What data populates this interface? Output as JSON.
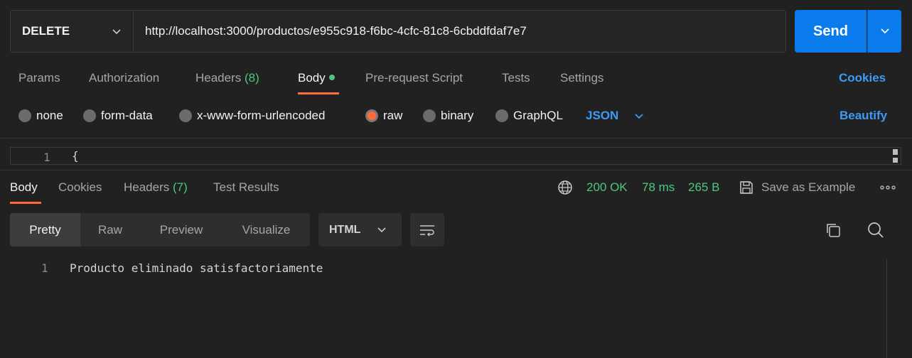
{
  "request": {
    "method": "DELETE",
    "url": "http://localhost:3000/productos/e955c918-f6bc-4cfc-81c8-6cbddfdaf7e7",
    "send_label": "Send"
  },
  "request_tabs": {
    "params": "Params",
    "authorization": "Authorization",
    "headers": "Headers",
    "headers_count": "(8)",
    "body": "Body",
    "pre_request": "Pre-request Script",
    "tests": "Tests",
    "settings": "Settings",
    "cookies": "Cookies"
  },
  "body_types": {
    "none": "none",
    "form_data": "form-data",
    "urlencoded": "x-www-form-urlencoded",
    "raw": "raw",
    "binary": "binary",
    "graphql": "GraphQL",
    "selected": "raw",
    "raw_format": "JSON",
    "beautify": "Beautify"
  },
  "editor": {
    "line_number": "1",
    "content": "{"
  },
  "response_tabs": {
    "body": "Body",
    "cookies": "Cookies",
    "headers": "Headers",
    "headers_count": "(7)",
    "test_results": "Test Results"
  },
  "response_status": {
    "code": "200 OK",
    "time": "78 ms",
    "size": "265 B",
    "save_example": "Save as Example"
  },
  "response_format": {
    "pretty": "Pretty",
    "raw": "Raw",
    "preview": "Preview",
    "visualize": "Visualize",
    "language": "HTML",
    "selected": "Pretty"
  },
  "response_body": {
    "line_number": "1",
    "content": "Producto eliminado satisfactoriamente"
  },
  "colors": {
    "accent_orange": "#ff6c37",
    "send_blue": "#097bed",
    "link_blue": "#3d9bf5",
    "status_green": "#49c980"
  },
  "icons": [
    "chevron-down-icon",
    "globe-icon",
    "save-icon",
    "more-icon",
    "copy-icon",
    "search-icon",
    "wrap-lines-icon"
  ]
}
